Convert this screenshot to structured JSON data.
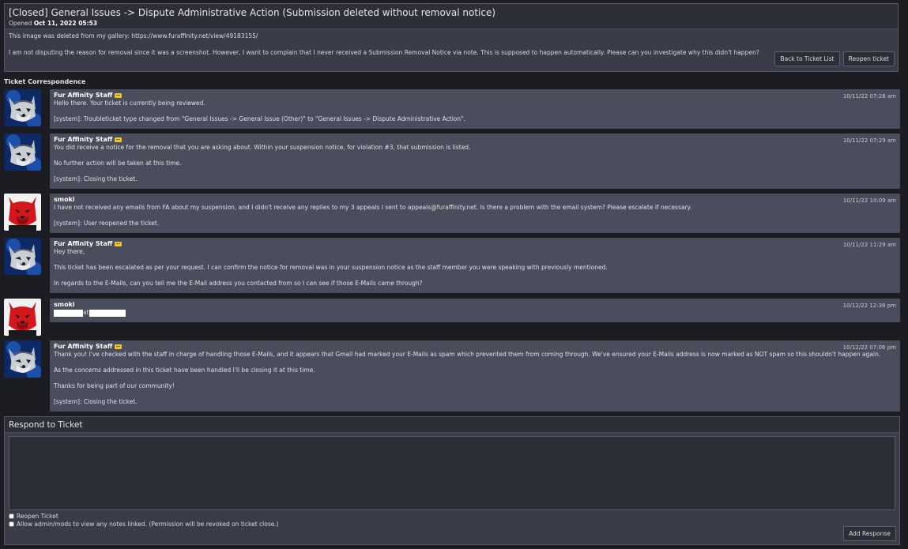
{
  "ticket": {
    "title": "[Closed] General Issues -> Dispute Administrative Action (Submission deleted without removal notice)",
    "opened_label": "Opened",
    "opened_date": "Oct 11, 2022 05:53",
    "body_line1": "This image was deleted from my gallery: https://www.furaffinity.net/view/49183155/",
    "body_line2": "I am not disputing the reason for removal since it was a screenshot. However, I want to complain that I never received a Submission Removal Notice via note. This is supposed to happen automatically. Please can you investigate why this didn't happen?",
    "back_button": "Back to Ticket List",
    "reopen_button": "Reopen ticket"
  },
  "correspondence": {
    "heading": "Ticket Correspondence",
    "entries": [
      {
        "author": "Fur Affinity Staff",
        "date": "10/11/22 07:28 am",
        "lines": [
          "Hello there. Your ticket is currently being reviewed.",
          "[system]: Troubleticket type changed from \"General Issues -> General Issue (Other)\" to \"General Issues -> Dispute Administrative Action\"."
        ]
      },
      {
        "author": "Fur Affinity Staff",
        "date": "10/11/22 07:29 am",
        "lines": [
          "You did receive a notice for the removal that you are asking about. Within your suspension notice, for violation #3, that submission is listed.",
          "No further action will be taken at this time.",
          "[system]: Closing the ticket."
        ]
      },
      {
        "author": "smoki",
        "date": "10/11/22 10:09 am",
        "lines": [
          "I have not received any emails from FA about my suspension, and I didn't receive any replies to my 3 appeals I sent to appeals@furaffinity.net. Is there a problem with the email system? Please escalate if necessary.",
          "[system]: User reopened the ticket."
        ]
      },
      {
        "author": "Fur Affinity Staff",
        "date": "10/11/22 11:29 am",
        "lines": [
          "Hey there,",
          "This ticket has been escalated as per your request. I can confirm the notice for removal was in your suspension notice as the staff member you were speaking with previously mentioned.",
          "In regards to the E-Mails, can you tell me the E-Mail address you contacted from so I can see if those E-Mails came through?"
        ]
      },
      {
        "author": "smoki",
        "date": "10/12/22 12:38 pm",
        "redacted_separator": "at"
      },
      {
        "author": "Fur Affinity Staff",
        "date": "10/12/22 07:06 pm",
        "lines": [
          "Thank you! I've checked with the staff in charge of handling those E-Mails, and it appears that Gmail had marked your E-Mails as spam which prevented them from coming through. We've ensured your E-Mails address is now marked as NOT spam so this shouldn't happen again.",
          "As the concerns addressed in this ticket have been handled I'll be closing it at this time.",
          "Thanks for being part of our community!",
          "[system]: Closing the ticket."
        ]
      }
    ]
  },
  "respond": {
    "title": "Respond to Ticket",
    "textarea_value": "",
    "reopen_label": "Reopen Ticket",
    "allow_notes_label": "Allow admin/mods to view any notes linked. (Permission will be revoked on ticket close.)",
    "add_button": "Add Response"
  },
  "colors": {
    "page_bg": "#1b1d22",
    "panel_bg": "#3a3d49",
    "message_bg": "#4a4d5b",
    "staff_badge": "#f1c232"
  },
  "icons": {
    "staff_avatar": "wolf-avatar-icon",
    "user_avatar": "red-fox-avatar-icon",
    "staff_badge": "staff-badge-icon"
  }
}
